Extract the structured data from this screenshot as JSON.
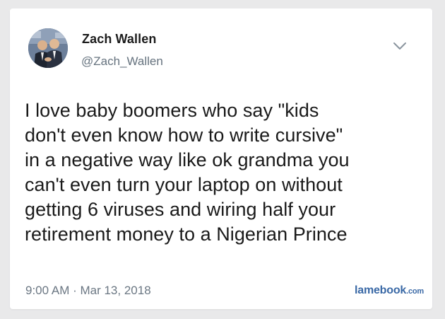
{
  "tweet": {
    "author_name": "Zach Wallen",
    "author_handle": "@Zach_Wallen",
    "avatar_icon": "user-avatar-photo",
    "menu_icon": "chevron-down-icon",
    "text": "I love baby boomers who say \"kids\ndon't even know how to write cursive\"\nin a negative way like ok grandma you\ncan't even turn your laptop on without\ngetting 6 viruses and wiring half your\nretirement money to a Nigerian Prince",
    "timestamp": "9:00 AM · Mar 13, 2018"
  },
  "watermark": {
    "brand": "lamebook",
    "tld": ".com",
    "color": "#3a69a6"
  },
  "colors": {
    "card_bg": "#ffffff",
    "page_bg": "#e9e9ea",
    "text": "#1a1a1a",
    "muted": "#65727e"
  }
}
